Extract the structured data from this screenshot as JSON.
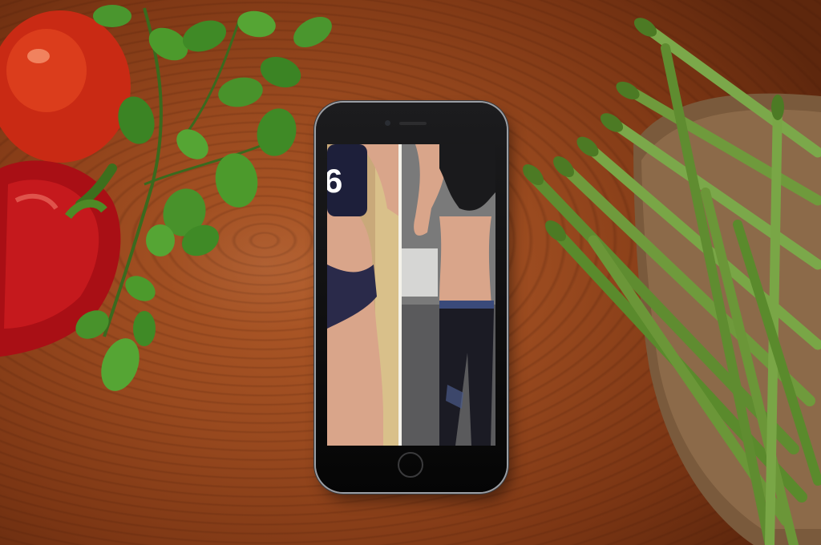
{
  "scene": {
    "description_items": [
      "tomato",
      "red-pepper",
      "basil",
      "asparagus",
      "basket",
      "smartphone"
    ]
  },
  "phone": {
    "screen": {
      "left_photo": {
        "jersey_number": "6"
      },
      "right_photo": {}
    }
  },
  "colors": {
    "wood": "#9a4a1f",
    "tomato": "#d8331a",
    "pepper": "#b8141a",
    "basil": "#3f8a2a",
    "asparagus": "#6f9a3c",
    "basket": "#8a6a4a"
  }
}
